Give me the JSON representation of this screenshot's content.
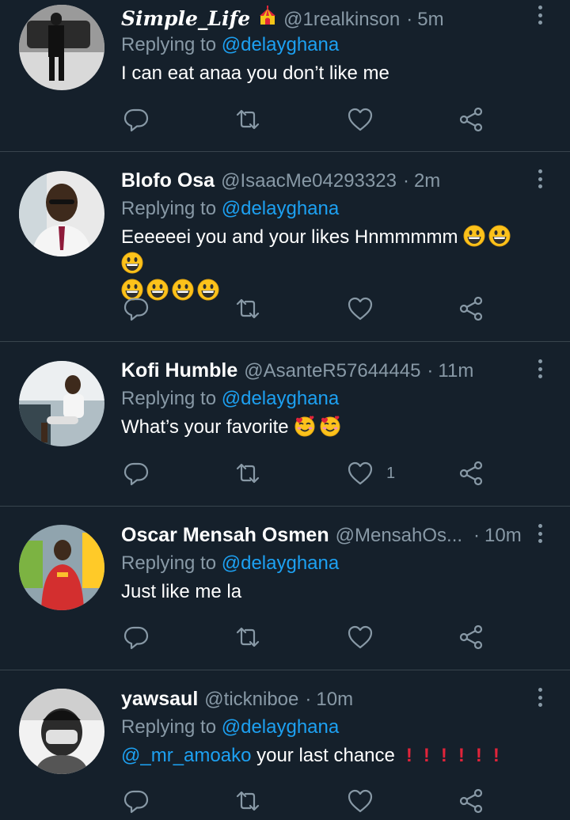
{
  "reply_prefix": "Replying to",
  "tweets": [
    {
      "name": "Simple_Life",
      "handle": "@1realkinson",
      "time": "5m",
      "replying_to": "@delayghana",
      "text": "I can eat anaa you don’t like me",
      "likes": ""
    },
    {
      "name": "Blofo Osa",
      "handle": "@IsaacMe04293323",
      "time": "2m",
      "replying_to": "@delayghana",
      "text": "Eeeeeei you and your likes Hnmmmmm",
      "likes": ""
    },
    {
      "name": "Kofi Humble",
      "handle": "@AsanteR57644445",
      "time": "11m",
      "replying_to": "@delayghana",
      "text": "What’s your favorite",
      "likes": "1"
    },
    {
      "name": "Oscar Mensah Osmen",
      "handle": "@MensahOs...",
      "time": "10m",
      "replying_to": "@delayghana",
      "text": "Just like me la",
      "likes": ""
    },
    {
      "name": "yawsaul",
      "handle": "@ticknibоe",
      "time": "10m",
      "replying_to": "@delayghana",
      "mention": "@_mr_amoako",
      "text": "your last chance",
      "likes": ""
    }
  ],
  "icons": {
    "reply": "reply-icon",
    "retweet": "retweet-icon",
    "like": "heart-icon",
    "share": "share-icon",
    "more": "more-vertical-icon"
  },
  "colors": {
    "background": "#15202b",
    "secondary_text": "#8899a6",
    "link": "#1da1f2",
    "divider": "#38444d"
  }
}
